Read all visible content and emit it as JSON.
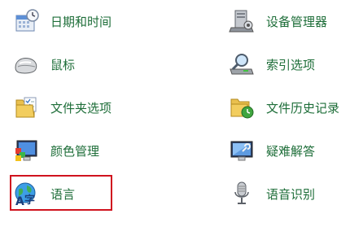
{
  "left_items": [
    {
      "label": "日期和时间",
      "icon": "calendar-clock-icon"
    },
    {
      "label": "鼠标",
      "icon": "mouse-icon"
    },
    {
      "label": "文件夹选项",
      "icon": "folder-options-icon"
    },
    {
      "label": "颜色管理",
      "icon": "color-management-icon"
    },
    {
      "label": "语言",
      "icon": "language-globe-icon"
    }
  ],
  "right_items": [
    {
      "label": "设备管理器",
      "icon": "device-manager-icon"
    },
    {
      "label": "索引选项",
      "icon": "indexing-options-icon"
    },
    {
      "label": "文件历史记录",
      "icon": "file-history-icon"
    },
    {
      "label": "疑难解答",
      "icon": "troubleshooting-icon"
    },
    {
      "label": "语音识别",
      "icon": "microphone-icon"
    }
  ],
  "highlighted_item": "语言",
  "colors": {
    "link": "#1e6e39",
    "highlight_border": "#d0131e"
  }
}
